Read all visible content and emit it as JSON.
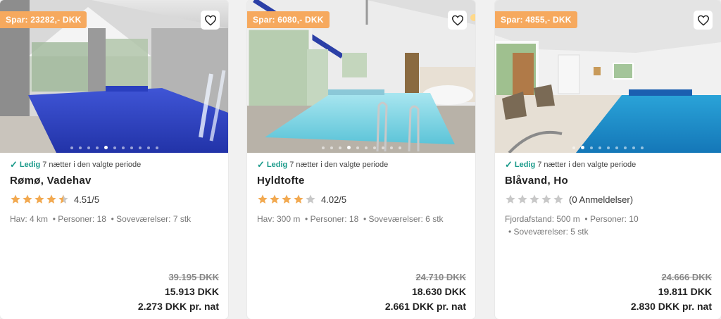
{
  "cards": [
    {
      "save_badge": "Spar: 23282,- DKK",
      "availability_status": "Ledig",
      "availability_text": "7 nætter i den valgte periode",
      "title": "Rømø, Vadehav",
      "rating_value": 4.51,
      "rating_text": "4.51/5",
      "facts": [
        "Hav: 4 km",
        "• Personer: 18",
        "• Soveværelser: 7 stk"
      ],
      "old_price": "39.195 DKK",
      "new_price": "15.913 DKK",
      "per_night": "2.273 DKK pr. nat",
      "carousel_total": 11,
      "carousel_active": 4
    },
    {
      "save_badge": "Spar: 6080,- DKK",
      "availability_status": "Ledig",
      "availability_text": "7 nætter i den valgte periode",
      "title": "Hyldtofte",
      "rating_value": 4.02,
      "rating_text": "4.02/5",
      "facts": [
        "Hav: 300 m",
        "• Personer: 18",
        "• Soveværelser: 6 stk"
      ],
      "old_price": "24.710 DKK",
      "new_price": "18.630 DKK",
      "per_night": "2.661 DKK pr. nat",
      "carousel_total": 10,
      "carousel_active": 3
    },
    {
      "save_badge": "Spar: 4855,- DKK",
      "availability_status": "Ledig",
      "availability_text": "7 nætter i den valgte periode",
      "title": "Blåvand, Ho",
      "rating_value": 0,
      "rating_text": "(0 Anmeldelser)",
      "facts": [
        "Fjordafstand: 500 m",
        "• Personer: 10",
        "• Soveværelser: 5 stk"
      ],
      "old_price": "24.666 DKK",
      "new_price": "19.811 DKK",
      "per_night": "2.830 DKK pr. nat",
      "carousel_total": 9,
      "carousel_active": 1
    }
  ],
  "colors": {
    "badge": "#f6a95e",
    "star_filled": "#f2a950",
    "star_empty": "#c8c8c8",
    "check": "#1a9a8a"
  },
  "icons": {
    "favorite": "heart-icon",
    "available": "checkmark-icon",
    "rating": "star-icon"
  }
}
